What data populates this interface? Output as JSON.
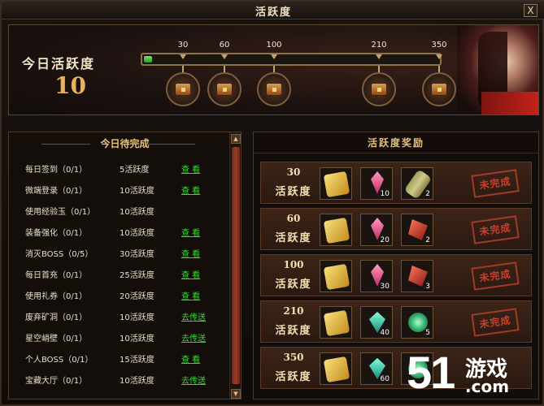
{
  "window": {
    "title": "活跃度",
    "close_label": "X"
  },
  "summary": {
    "today_label": "今日活跃度",
    "today_value": "10",
    "progress_fraction": 0.029,
    "milestones": [
      "30",
      "60",
      "100",
      "210",
      "350"
    ]
  },
  "tasks_panel": {
    "title": "今日待完成",
    "tasks": [
      {
        "name": "每日签到（0/1）",
        "points": "5活跃度",
        "action": "查  看"
      },
      {
        "name": "微端登录（0/1）",
        "points": "10活跃度",
        "action": "查  看"
      },
      {
        "name": "使用经验玉（0/1）",
        "points": "10活跃度",
        "action": ""
      },
      {
        "name": "装备强化（0/1）",
        "points": "10活跃度",
        "action": "查  看"
      },
      {
        "name": "消灭BOSS（0/5）",
        "points": "30活跃度",
        "action": "查  看"
      },
      {
        "name": "每日首充（0/1）",
        "points": "25活跃度",
        "action": "查  看"
      },
      {
        "name": "使用礼券（0/1）",
        "points": "20活跃度",
        "action": "查  看"
      },
      {
        "name": "废弃矿洞（0/1）",
        "points": "10活跃度",
        "action": "去传送"
      },
      {
        "name": "星空峭壁（0/1）",
        "points": "10活跃度",
        "action": "去传送"
      },
      {
        "name": "个人BOSS（0/1）",
        "points": "15活跃度",
        "action": "查  看"
      },
      {
        "name": "宝藏大厅（0/1）",
        "points": "10活跃度",
        "action": "去传送"
      }
    ]
  },
  "rewards_panel": {
    "title": "活跃度奖励",
    "unit_label": "活跃度",
    "status_label": "未完成",
    "rows": [
      {
        "points": "30",
        "items": [
          {
            "icon": "gold-ticket-icon",
            "count": ""
          },
          {
            "icon": "pink-gem-icon",
            "count": "10"
          },
          {
            "icon": "scroll-item-icon",
            "count": "2"
          }
        ]
      },
      {
        "points": "60",
        "items": [
          {
            "icon": "gold-ticket-icon",
            "count": ""
          },
          {
            "icon": "pink-gem-icon",
            "count": "20"
          },
          {
            "icon": "red-shard-icon",
            "count": "2"
          }
        ]
      },
      {
        "points": "100",
        "items": [
          {
            "icon": "gold-ticket-icon",
            "count": ""
          },
          {
            "icon": "pink-gem-icon",
            "count": "30"
          },
          {
            "icon": "red-shard-icon",
            "count": "3"
          }
        ]
      },
      {
        "points": "210",
        "items": [
          {
            "icon": "gold-ticket-icon",
            "count": ""
          },
          {
            "icon": "teal-gem-icon",
            "count": "40"
          },
          {
            "icon": "green-orb-icon",
            "count": "5"
          }
        ]
      },
      {
        "points": "350",
        "items": [
          {
            "icon": "gold-ticket-icon",
            "count": ""
          },
          {
            "icon": "teal-gem-icon",
            "count": "60"
          },
          {
            "icon": "green-orb-icon",
            "count": ""
          }
        ]
      }
    ]
  },
  "watermark": {
    "number": "51",
    "brand": "游戏",
    "domain": ".com"
  }
}
